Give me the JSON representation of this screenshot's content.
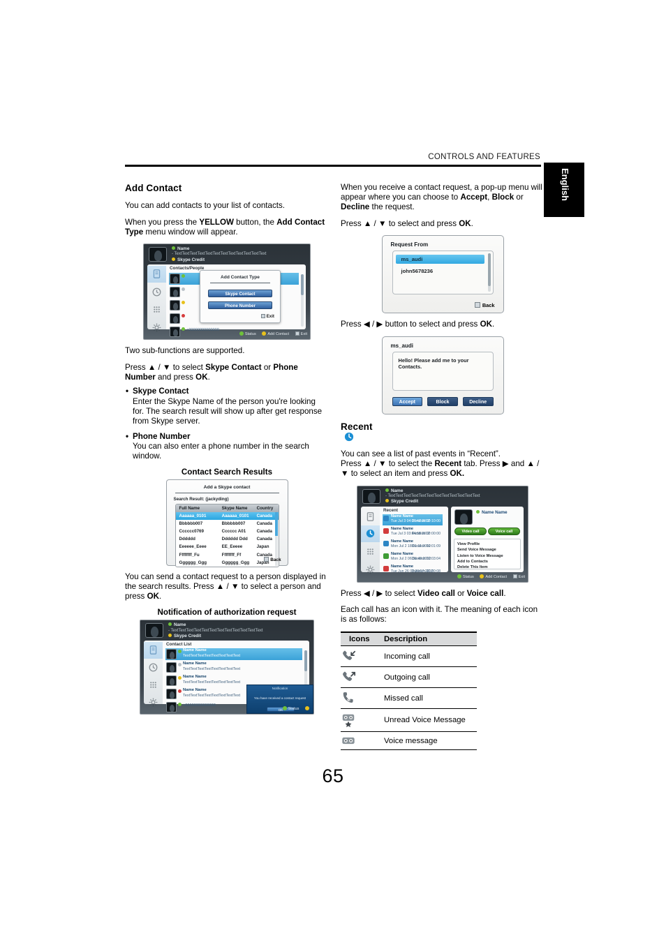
{
  "header": {
    "running_head": "CONTROLS AND FEATURES",
    "language_tab": "English"
  },
  "page_number": "65",
  "left_column": {
    "heading": "Add Contact",
    "para_1": "You can add contacts to your list of contacts.",
    "para_2_pre": "When you press the ",
    "para_2_b1": "YELLOW",
    "para_2_mid": " button, the ",
    "para_2_b2": "Add Contact Type",
    "para_2_post": " menu window will appear.",
    "para_3": "Two sub-functions are supported.",
    "para_4_pre": "Press ▲ / ▼ to select ",
    "para_4_b1": "Skype Contact",
    "para_4_mid": " or ",
    "para_4_b2": "Phone Number",
    "para_4_post": " and press ",
    "para_4_b3": "OK",
    "para_4_end": ".",
    "bullets": [
      {
        "title": "Skype Contact",
        "body": "Enter the Skype Name of the person you're looking for. The search result will show up after get response from Skype server."
      },
      {
        "title": "Phone Number",
        "body": "You can also enter a phone number in the search window."
      }
    ],
    "fig_caption_search": "Contact Search Results",
    "para_5_pre": "You can send a contact request to a person displayed in the search results. Press ▲ / ▼ to select a person and press ",
    "para_5_b": "OK",
    "para_5_post": ".",
    "fig_caption_notify": "Notification of authorization request"
  },
  "right_column": {
    "para_1_pre": "When you receive a contact request, a pop-up menu will appear where you can choose to ",
    "para_1_b1": "Accept",
    "para_1_sep1": ", ",
    "para_1_b2": "Block",
    "para_1_sep2": " or ",
    "para_1_b3": "Decline",
    "para_1_post": " the request.",
    "para_2_pre": "Press ▲ / ▼ to select and press ",
    "para_2_b": "OK",
    "para_2_post": ".",
    "para_3_pre": "Press ◀ / ▶ button to select and press ",
    "para_3_b": "OK",
    "para_3_post": ".",
    "recent_heading": "Recent",
    "recent_para_1": "You can see a list of past events in “Recent”.",
    "recent_para_2_pre": "Press ▲ / ▼ to select the ",
    "recent_para_2_b1": "Recent",
    "recent_para_2_mid": " tab. Press ▶ and ▲ / ▼ to select an item and press ",
    "recent_para_2_b2": "OK.",
    "para_4_pre": "Press ◀ / ▶ to select ",
    "para_4_b1": "Video call",
    "para_4_mid": " or ",
    "para_4_b2": "Voice call",
    "para_4_post": ".",
    "para_5": "Each call has an icon with it. The meaning of each icon is as follows:"
  },
  "icons_table": {
    "headers": [
      "Icons",
      "Description"
    ],
    "rows": [
      {
        "icon": "incoming-call-icon",
        "description": "Incoming call"
      },
      {
        "icon": "outgoing-call-icon",
        "description": "Outgoing call"
      },
      {
        "icon": "missed-call-icon",
        "description": "Missed call"
      },
      {
        "icon": "unread-voice-message-icon",
        "description": "Unread Voice Message"
      },
      {
        "icon": "voice-message-icon",
        "description": "Voice message"
      }
    ]
  },
  "figure_add_contact_type": {
    "account_name": "Name",
    "account_detail": "- TextTextTextTextTextTextTextTextTextTextTextText",
    "account_credit": "Skype Credit",
    "panel_title": "Contacts/People",
    "modal_title": "Add Contact Type",
    "modal_button_1": "Skype Contact",
    "modal_button_2": "Phone Number",
    "modal_exit": "Exit",
    "phone_entry": "+00000000000000",
    "status_bar": [
      "Status",
      "Add Contact",
      "Exit"
    ]
  },
  "figure_contact_search": {
    "title": "Add a Skype contact",
    "subtitle": "Search Result: (jackyding)",
    "columns": [
      "Full Name",
      "Skype Name",
      "Country"
    ],
    "rows": [
      {
        "full_name": "Aaaaaa_0101",
        "skype_name": "Aaaaaa_0101",
        "country": "Canada",
        "selected": true
      },
      {
        "full_name": "Bbbbbb007",
        "skype_name": "Bbbbbb007",
        "country": "Canada",
        "selected": false
      },
      {
        "full_name": "Cccccc0769",
        "skype_name": "Cccccc A01",
        "country": "Canada",
        "selected": false
      },
      {
        "full_name": "Dddddd",
        "skype_name": "Dddddd Ddd",
        "country": "Canada",
        "selected": false
      },
      {
        "full_name": "Eeeeee_Eeee",
        "skype_name": "EE_Eeeee",
        "country": "Japan",
        "selected": false
      },
      {
        "full_name": "Ffffffff_Fu",
        "skype_name": "Ffffffff_Ff",
        "country": "Canada",
        "selected": false
      },
      {
        "full_name": "Gggggg_Ggg",
        "skype_name": "Gggggg_Ggg",
        "country": "Japan",
        "selected": false
      }
    ],
    "back_label": "Back"
  },
  "figure_notification": {
    "account_name": "Name",
    "account_detail": "- TextTextTextTextTextTextTextTextTextTextTextText",
    "account_credit": "Skype Credit",
    "panel_title": "Contact List",
    "contacts": [
      {
        "name": "Name Name",
        "text": "TextTextTextTextTextTextTextText",
        "status": "online",
        "selected": true
      },
      {
        "name": "Name Name",
        "text": "TextTextTextTextTextTextTextText",
        "status": "offline",
        "selected": false
      },
      {
        "name": "Name Name",
        "text": "TextTextTextTextTextTextTextText",
        "status": "away",
        "selected": false
      },
      {
        "name": "Name Name",
        "text": "TextTextTextTextTextTextTextText",
        "status": "busy",
        "selected": false
      }
    ],
    "phone_entry": "+00000000000000",
    "toast_title": "Notification",
    "toast_body": "You have received a contact request",
    "toast_button": "OK",
    "status_bar": [
      "Status",
      "Add Contact",
      "Exit"
    ]
  },
  "figure_recent": {
    "account_name": "Name",
    "account_detail": "- TextTextTextTextTextTextTextTextTextTextTextText",
    "account_credit": "Skype Credit",
    "panel_title": "Recent",
    "entries": [
      {
        "name": "Name Name",
        "date": "Tue Jul 3 04:07:47 2012",
        "duration": "Duration 00:10:00",
        "selected": true
      },
      {
        "name": "Name Name",
        "date": "Tue Jul 3 03:44:58 2012",
        "duration": "Duration 00:00:00",
        "selected": false
      },
      {
        "name": "Name Name",
        "date": "Mon Jul 2 18:01:11 2012",
        "duration": "Duration 00:01:09",
        "selected": false
      },
      {
        "name": "Name Name",
        "date": "Mon Jul 2 06:36:49 2012",
        "duration": "Duration 00:03:04",
        "selected": false
      },
      {
        "name": "Name Name",
        "date": "Tue Jun 26 03:30:17 2012",
        "duration": "Duration 00:00:08",
        "selected": false
      }
    ],
    "contact_name": "Name Name",
    "button_video": "Video call",
    "button_voice": "Voice call",
    "menu": [
      "View Profile",
      "Send Voice Message",
      "Listen to Voice Message",
      "Add to Contacts",
      "Delete This Item"
    ],
    "status_bar": [
      "Status",
      "Add Contact",
      "Exit"
    ]
  },
  "colors": {
    "accent_blue": "#2aa6e0",
    "skype_blue": "#1194d4",
    "green_button": "#3d8f22",
    "header_gray": "#d9dadb"
  }
}
